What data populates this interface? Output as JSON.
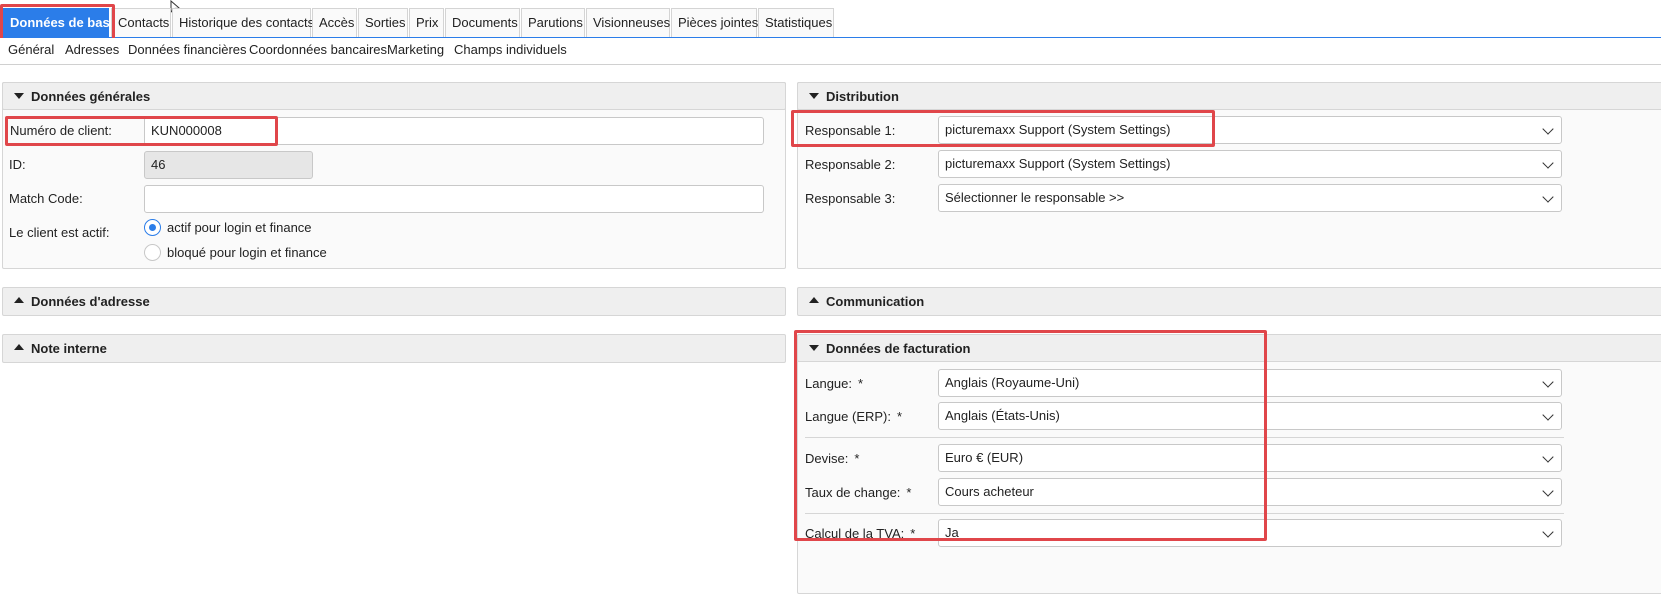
{
  "tabs": [
    {
      "label": "Données de base",
      "active": true
    },
    {
      "label": "Contacts"
    },
    {
      "label": "Historique des contacts"
    },
    {
      "label": "Accès"
    },
    {
      "label": "Sorties"
    },
    {
      "label": "Prix"
    },
    {
      "label": "Documents"
    },
    {
      "label": "Parutions"
    },
    {
      "label": "Visionneuses"
    },
    {
      "label": "Pièces jointes"
    },
    {
      "label": "Statistiques"
    }
  ],
  "subtabs": [
    "Général",
    "Adresses",
    "Données financières",
    "Coordonnées bancaires",
    "Marketing",
    "Champs individuels"
  ],
  "general": {
    "title": "Données générales",
    "customer_number_label": "Numéro de client:",
    "customer_number_value": "KUN000008",
    "id_label": "ID:",
    "id_value": "46",
    "match_code_label": "Match Code:",
    "match_code_value": "",
    "active_label": "Le client est actif:",
    "radio_active": "actif pour login et finance",
    "radio_blocked": "bloqué pour login et finance"
  },
  "address": {
    "title": "Données d'adresse"
  },
  "note": {
    "title": "Note interne"
  },
  "distribution": {
    "title": "Distribution",
    "rows": [
      {
        "label": "Responsable 1:",
        "value": "picturemaxx Support (System Settings)"
      },
      {
        "label": "Responsable 2:",
        "value": "picturemaxx Support (System Settings)"
      },
      {
        "label": "Responsable 3:",
        "value": "Sélectionner le responsable >>"
      }
    ]
  },
  "communication": {
    "title": "Communication"
  },
  "billing": {
    "title": "Données de facturation",
    "required_mark": "*",
    "rows": [
      {
        "label": "Langue:",
        "value": "Anglais (Royaume-Uni)"
      },
      {
        "label": "Langue (ERP):",
        "value": "Anglais (États-Unis)"
      },
      {
        "label": "Devise:",
        "value": "Euro € (EUR)"
      },
      {
        "label": "Taux de change:",
        "value": "Cours acheteur"
      },
      {
        "label": "Calcul de la TVA:",
        "value": "Ja"
      }
    ]
  },
  "colors": {
    "accent": "#2b7de9",
    "highlight": "#e0464a"
  }
}
